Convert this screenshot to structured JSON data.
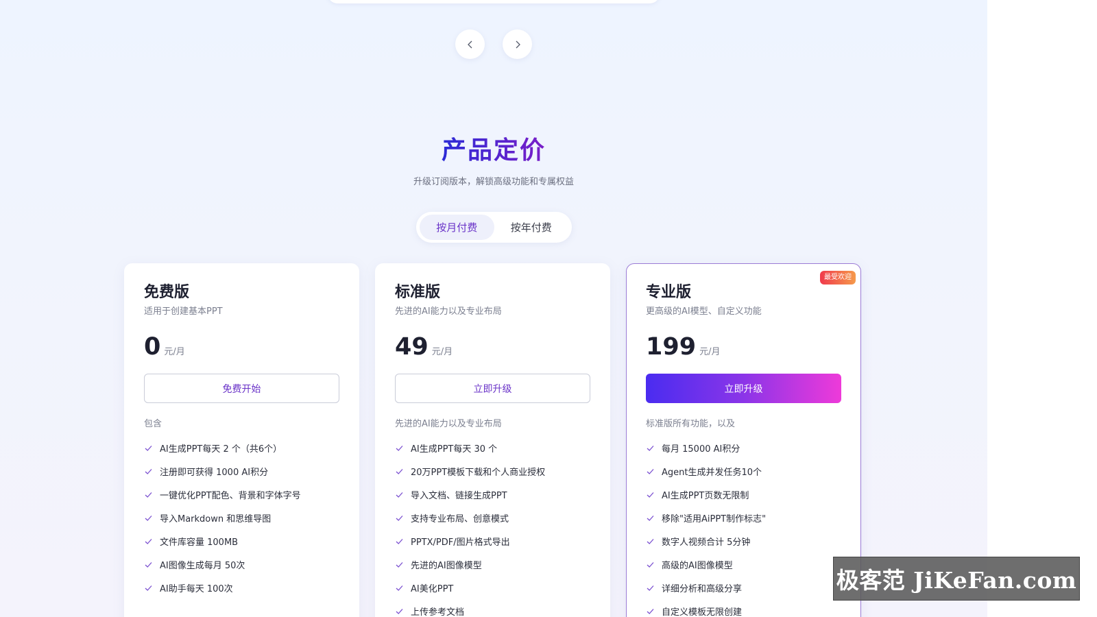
{
  "carousel": {
    "prev_icon": "chevron-left-icon",
    "next_icon": "chevron-right-icon"
  },
  "pricing": {
    "title": "产品定价",
    "subtitle": "升级订阅版本，解锁高级功能和专属权益",
    "billing_options": {
      "monthly": "按月付费",
      "yearly": "按年付费",
      "selected": "monthly"
    },
    "plans": [
      {
        "name": "免费版",
        "description": "适用于创建基本PPT",
        "price": "0",
        "unit": "元/月",
        "button": "免费开始",
        "features_heading": "包含",
        "features": [
          "AI生成PPT每天 2 个（共6个）",
          "注册即可获得 1000 AI积分",
          "一键优化PPT配色、背景和字体字号",
          "导入Markdown 和思维导图",
          "文件库容量 100MB",
          "AI图像生成每月 50次",
          "AI助手每天 100次"
        ]
      },
      {
        "name": "标准版",
        "description": "先进的AI能力以及专业布局",
        "price": "49",
        "unit": "元/月",
        "button": "立即升级",
        "features_heading": "先进的AI能力以及专业布局",
        "features": [
          "AI生成PPT每天 30 个",
          "20万PPT模板下载和个人商业授权",
          "导入文档、链接生成PPT",
          "支持专业布局、创意模式",
          "PPTX/PDF/图片格式导出",
          "先进的AI图像模型",
          "AI美化PPT",
          "上传参考文档"
        ]
      },
      {
        "name": "专业版",
        "badge": "最受欢迎",
        "description": "更高级的AI模型、自定义功能",
        "price": "199",
        "unit": "元/月",
        "button": "立即升级",
        "features_heading": "标准版所有功能，以及",
        "features": [
          "每月 15000 AI积分",
          "Agent生成并发任务10个",
          "AI生成PPT页数无限制",
          "移除\"适用AiPPT制作标志\"",
          "数字人视频合计 5分钟",
          "高级的AI图像模型",
          "详细分析和高级分享",
          "自定义模板无限创建"
        ]
      }
    ]
  },
  "watermark": {
    "text": "极客范 JiKeFan.com"
  },
  "colors": {
    "accent": "#6a33c8",
    "check": "#7a4fd0",
    "badge_start": "#f03a4c",
    "badge_end": "#f59a4b",
    "primary_gradient_start": "#4a2cf0",
    "primary_gradient_end": "#ee3ad9"
  }
}
